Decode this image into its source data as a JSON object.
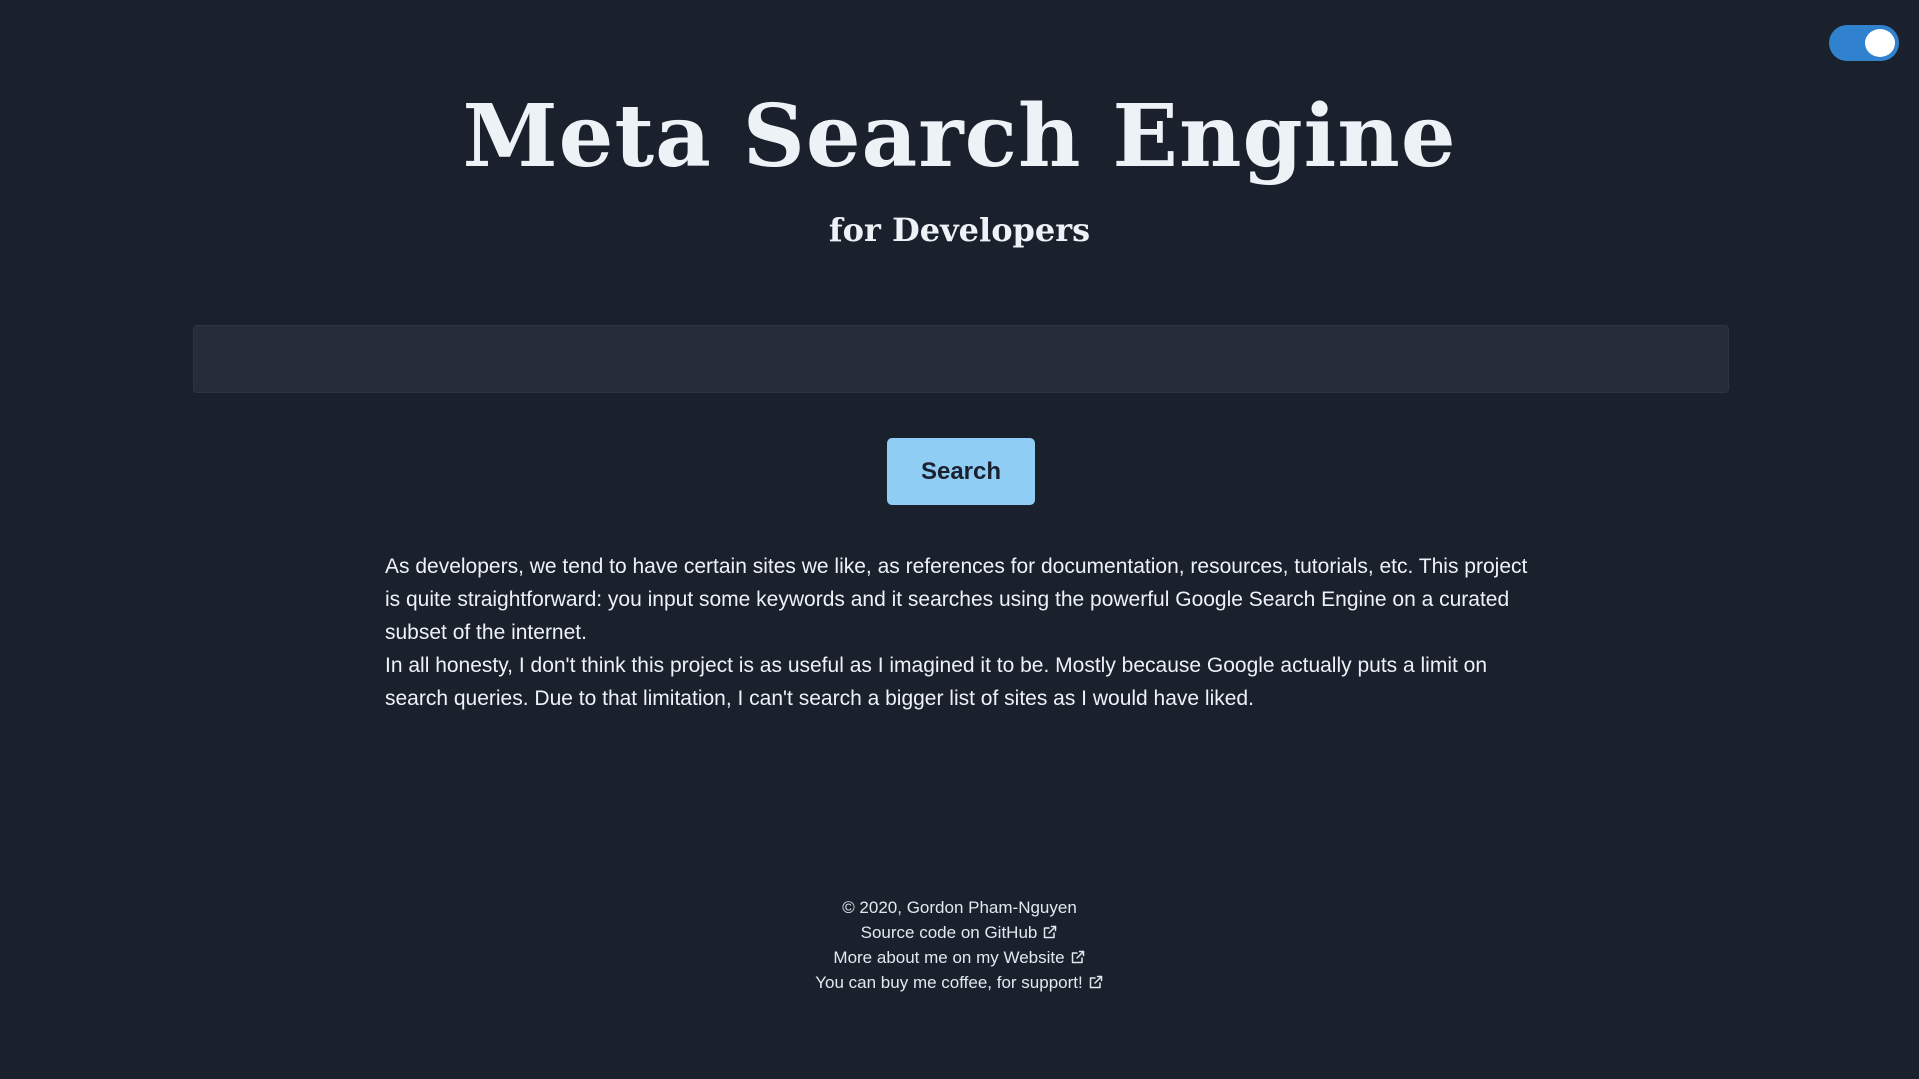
{
  "header": {
    "title": "Meta Search Engine",
    "subtitle": "for Developers"
  },
  "theme_toggle": {
    "state": "on",
    "accent": "#3182ce"
  },
  "search": {
    "value": "",
    "placeholder": "",
    "button_label": "Search",
    "button_color": "#90cdf4"
  },
  "description": {
    "paragraph_1": "As developers, we tend to have certain sites we like, as references for documentation, resources, tutorials, etc. This project is quite straightforward: you input some keywords and it searches using the powerful Google Search Engine on a curated subset of the internet.",
    "paragraph_2": "In all honesty, I don't think this project is as useful as I imagined it to be. Mostly because Google actually puts a limit on search queries. Due to that limitation, I can't search a bigger list of sites as I would have liked."
  },
  "footer": {
    "copyright": "© 2020, Gordon Pham-Nguyen",
    "links": [
      {
        "label": "Source code on GitHub",
        "icon": "external-link-icon"
      },
      {
        "label": "More about me on my Website",
        "icon": "external-link-icon"
      },
      {
        "label": "You can buy me coffee, for support!",
        "icon": "external-link-icon"
      }
    ]
  },
  "colors": {
    "background": "#1a202c",
    "input_background": "#262c38",
    "text": "#edf2f7"
  }
}
